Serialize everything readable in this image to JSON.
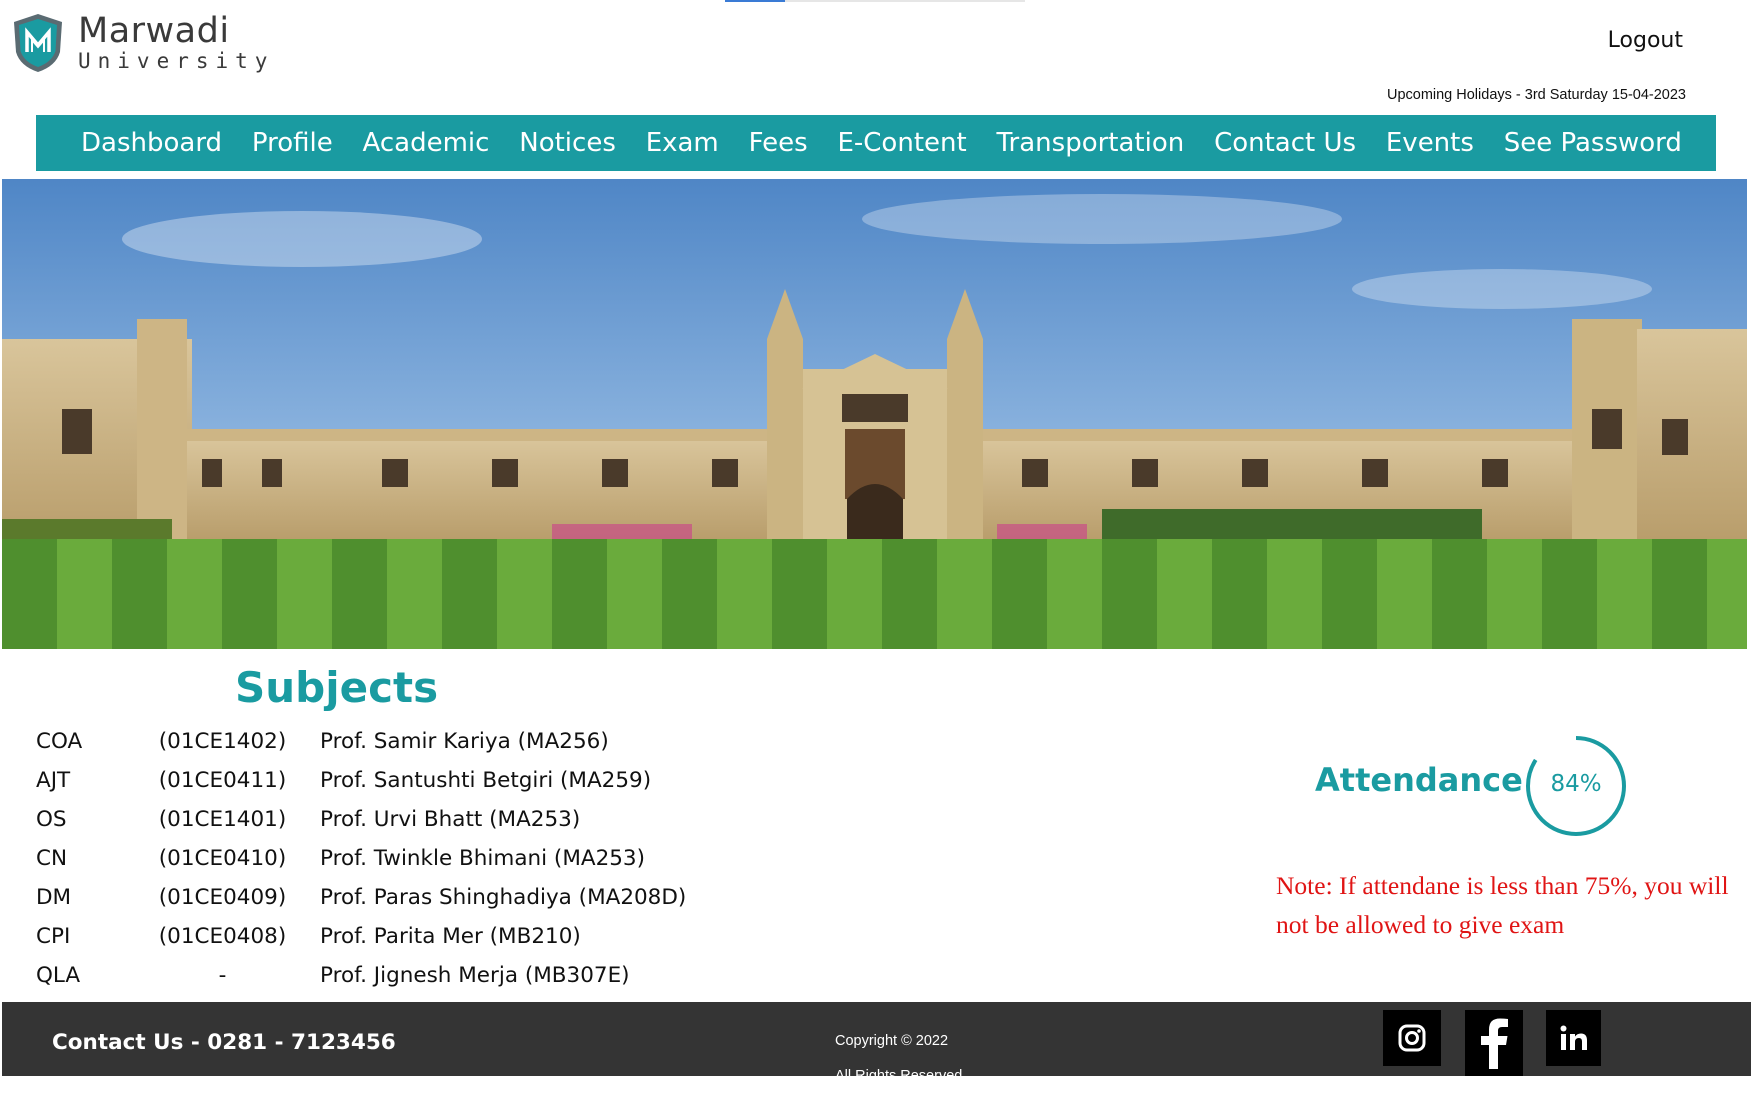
{
  "header": {
    "brand_name": "Marwadi",
    "brand_sub": "University",
    "logout_label": "Logout",
    "holiday_notice": "Upcoming Holidays - 3rd Saturday 15-04-2023"
  },
  "nav": {
    "items": [
      "Dashboard",
      "Profile",
      "Academic",
      "Notices",
      "Exam",
      "Fees",
      "E-Content",
      "Transportation",
      "Contact Us",
      "Events",
      "See Password"
    ]
  },
  "subjects": {
    "title": "Subjects",
    "rows": [
      {
        "abbr": "COA",
        "code": "(01CE1402)",
        "professor": "Prof. Samir Kariya (MA256)"
      },
      {
        "abbr": "AJT",
        "code": "(01CE0411)",
        "professor": "Prof. Santushti Betgiri (MA259)"
      },
      {
        "abbr": "OS",
        "code": "(01CE1401)",
        "professor": "Prof. Urvi Bhatt (MA253)"
      },
      {
        "abbr": "CN",
        "code": "(01CE0410)",
        "professor": "Prof. Twinkle Bhimani (MA253)"
      },
      {
        "abbr": "DM",
        "code": "(01CE0409)",
        "professor": "Prof. Paras Shinghadiya (MA208D)"
      },
      {
        "abbr": "CPI",
        "code": "(01CE0408)",
        "professor": "Prof. Parita Mer (MB210)"
      },
      {
        "abbr": "QLA",
        "code": "-",
        "professor": "Prof. Jignesh Merja (MB307E)"
      }
    ]
  },
  "attendance": {
    "label": "Attendance",
    "percent_text": "84%",
    "percent": 84,
    "note": "Note: If attendane is less than 75%, you will not be allowed to give exam"
  },
  "footer": {
    "contact": "Contact Us - 0281 - 7123456",
    "copyright_line1": "Copyright © 2022",
    "copyright_line2": "All Rights Reserved.",
    "social": [
      "instagram-icon",
      "facebook-icon",
      "linkedin-icon"
    ]
  },
  "colors": {
    "accent": "#1a9ba1",
    "note_red": "#e01414",
    "footer_bg": "#343434"
  }
}
